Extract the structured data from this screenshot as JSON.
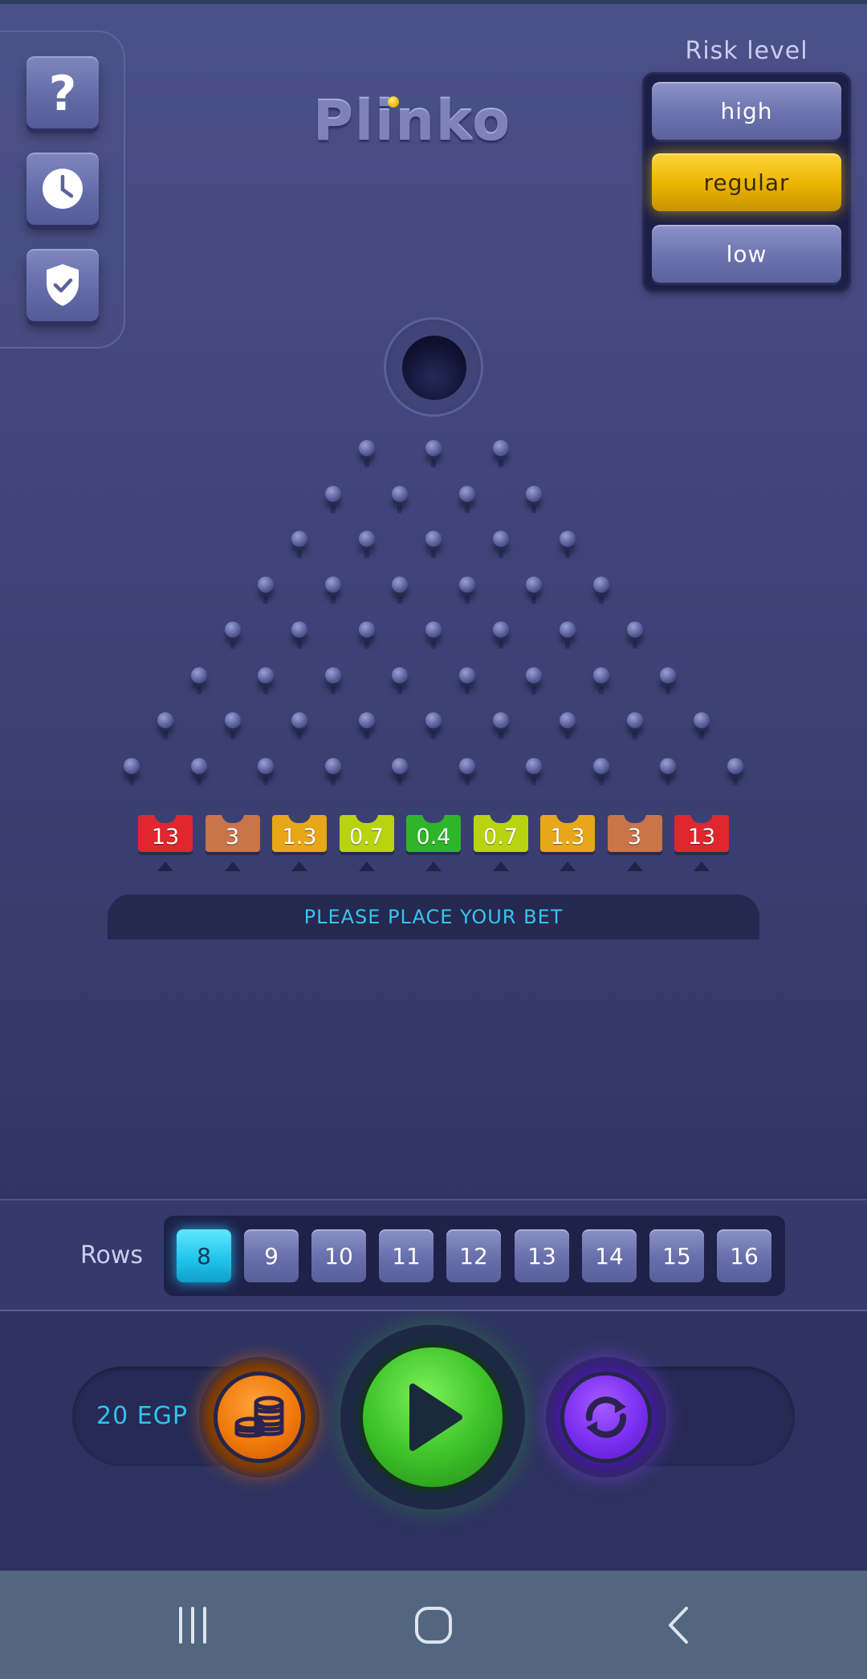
{
  "app": {
    "logo_text": "Plinko"
  },
  "tools": [
    {
      "name": "help",
      "icon": "question-icon"
    },
    {
      "name": "history",
      "icon": "clock-icon"
    },
    {
      "name": "fairness",
      "icon": "shield-check-icon"
    }
  ],
  "risk": {
    "label": "Risk level",
    "options": [
      "high",
      "regular",
      "low"
    ],
    "selected": "regular"
  },
  "board": {
    "rows": 8,
    "multipliers": [
      "13",
      "3",
      "1.3",
      "0.7",
      "0.4",
      "0.7",
      "1.3",
      "3",
      "13"
    ],
    "bucket_colors": [
      "#e0262e",
      "#c9744a",
      "#e8a619",
      "#b8d40e",
      "#2fb52a",
      "#b8d40e",
      "#e8a619",
      "#c9744a",
      "#e0262e"
    ]
  },
  "status": {
    "message": "PLEASE PLACE YOUR BET"
  },
  "rows": {
    "label": "Rows",
    "options": [
      "8",
      "9",
      "10",
      "11",
      "12",
      "13",
      "14",
      "15",
      "16"
    ],
    "selected": "8"
  },
  "controls": {
    "bet_amount": "20 EGP",
    "bet_icon": "coins-icon",
    "play_icon": "play-icon",
    "autoplay_icon": "refresh-icon"
  },
  "system_nav": {
    "items": [
      "recents-icon",
      "home-icon",
      "back-icon"
    ]
  },
  "colors": {
    "accent_yellow": "#e9b300",
    "accent_cyan": "#1fc2ea",
    "play_green": "#3fc42a",
    "bet_orange": "#f07a0a",
    "autoplay_purple": "#7a2ff0"
  }
}
